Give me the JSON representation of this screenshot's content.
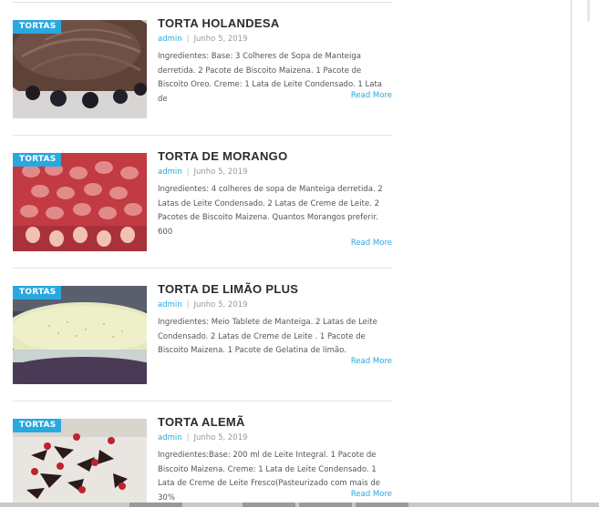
{
  "posts": [
    {
      "category": "TORTAS",
      "title": "TORTA HOLANDESA",
      "author": "admin",
      "date": "Junho 5, 2019",
      "excerpt": "Ingredientes: Base: 3 Colheres de Sopa de Manteiga derretida. 2 Pacote de Biscoito Maizena. 1 Pacote de Biscoito Oreo. Creme: 1 Lata de Leite Condensado. 1 Lata de",
      "more": "Read More",
      "image": "chocolate-tart-photo"
    },
    {
      "category": "TORTAS",
      "title": "TORTA DE MORANGO",
      "author": "admin",
      "date": "Junho 5, 2019",
      "excerpt": "Ingredientes: 4 colheres de sopa de Manteiga derretida. 2 Latas de Leite Condensado. 2 Latas de Creme de Leite. 2 Pacotes de Biscoito Maizena.  Quantos Morangos preferir. 600",
      "more": "Read More",
      "image": "strawberry-tart-photo"
    },
    {
      "category": "TORTAS",
      "title": "TORTA DE LIMÃO PLUS",
      "author": "admin",
      "date": "Junho 5, 2019",
      "excerpt": "Ingredientes: Meio Tablete de Manteiga. 2 Latas de Leite Condensado. 2 Latas de Creme de Leite . 1 Pacote de Biscoito Maizena. 1 Pacote de Gelatina de limão.",
      "more": "Read More",
      "image": "lemon-tart-photo"
    },
    {
      "category": "TORTAS",
      "title": "TORTA ALEMÃ",
      "author": "admin",
      "date": "Junho 5, 2019",
      "excerpt": "Ingredientes:Base: 200 ml de Leite Integral. 1 Pacote de Biscoito Maizena. Creme: 1 Lata de Leite Condensado. 1 Lata de Creme de Leite Fresco(Pasteurizado com mais de 30%",
      "more": "Read More",
      "image": "german-tart-photo"
    }
  ],
  "colors": {
    "accent": "#29a8df",
    "title": "#2c2c2c",
    "meta": "#999999"
  }
}
